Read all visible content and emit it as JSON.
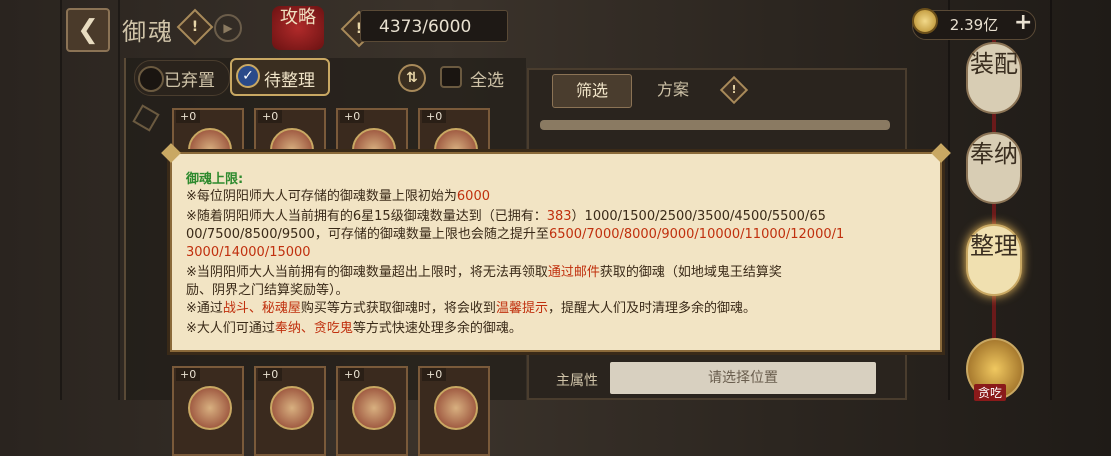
{
  "header": {
    "back_icon": "back-arrow-icon",
    "title": "御魂",
    "strategy_label": "攻略",
    "capacity": "4373/6000",
    "gold": "2.39亿",
    "plus": "+"
  },
  "filters": {
    "discard": "已弃置",
    "pending": "待整理",
    "sort_icon": "⇅",
    "select_all": "全选"
  },
  "cards": [
    {
      "level": "+0"
    },
    {
      "level": "+0"
    },
    {
      "level": "+0"
    },
    {
      "level": "+0"
    },
    {
      "level": "+0"
    },
    {
      "level": "+0"
    },
    {
      "level": "+0"
    },
    {
      "level": "+0"
    }
  ],
  "right_panel": {
    "tab_filter": "筛选",
    "tab_scheme": "方案",
    "main_attr_label": "主属性",
    "main_attr_placeholder": "请选择位置"
  },
  "side_buttons": {
    "equip": "装配",
    "offer": "奉纳",
    "organize": "整理",
    "greedy": "贪吃"
  },
  "tooltip": {
    "title": "御魂上限:",
    "l1_a": "※每位阴阳师大人可存储的御魂数量上限初始为",
    "l1_b": "6000",
    "l2_a": "※随着阴阳师大人当前拥有的6星15级御魂数量达到（已拥有：",
    "l2_b": "383",
    "l2_c": "）1000/1500/2500/3500/4500/5500/65",
    "l3_a": "00/7500/8500/9500，可存储的御魂数量上限也会随之提升至",
    "l3_b": "6500/7000/8000/9000/10000/11000/12000/1",
    "l4": "3000/14000/15000",
    "l5_a": "※当阴阳师大人当前拥有的御魂数量超出上限时，将无法再领取",
    "l5_b": "通过邮件",
    "l5_c": "获取的御魂（如地域鬼王结算奖",
    "l6": "励、阴界之门结算奖励等）。",
    "l7_a": "※通过",
    "l7_b": "战斗、秘魂屋",
    "l7_c": "购买等方式获取御魂时，将会收到",
    "l7_d": "温馨提示",
    "l7_e": "，提醒大人们及时清理多余的御魂。",
    "l8_a": "※大人们可通过",
    "l8_b": "奉纳、贪吃鬼",
    "l8_c": "等方式快速处理多余的御魂。"
  }
}
